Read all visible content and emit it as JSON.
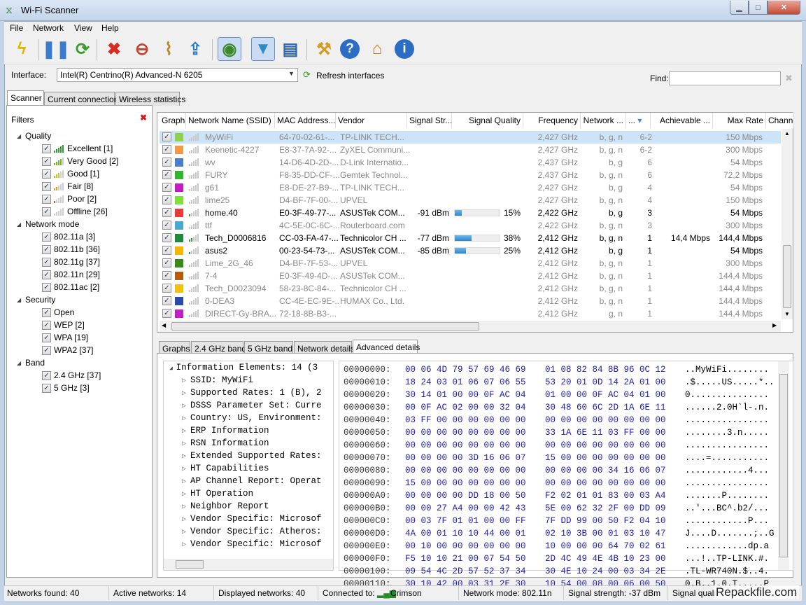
{
  "window": {
    "title": "Wi-Fi Scanner",
    "min": "▭",
    "max": "□",
    "close": "✕"
  },
  "menu": [
    "File",
    "Network",
    "View",
    "Help"
  ],
  "toolbar": [
    {
      "icon": "lightning-icon",
      "glyph": "ϟ",
      "color": "#e8b400"
    },
    {
      "icon": "pause-icon",
      "glyph": "❚❚",
      "color": "#3b7bcf"
    },
    {
      "icon": "refresh-icon",
      "glyph": "⟳",
      "color": "#3a9a2a"
    },
    {
      "icon": "delete-icon",
      "glyph": "✖",
      "color": "#d92b1f"
    },
    {
      "icon": "signal-remove-icon",
      "glyph": "⊖",
      "color": "#c9402f"
    },
    {
      "icon": "broom-icon",
      "glyph": "⌇",
      "color": "#b8862c"
    },
    {
      "icon": "export-icon",
      "glyph": "⇪",
      "color": "#2f7bc4"
    },
    {
      "icon": "rss-alert-icon",
      "glyph": "◉",
      "color": "#3a8a2a"
    },
    {
      "icon": "filter-icon",
      "glyph": "▼",
      "color": "#2f8bc8"
    },
    {
      "icon": "notebook-icon",
      "glyph": "▤",
      "color": "#2f67b0"
    },
    {
      "icon": "wrench-icon",
      "glyph": "⚒",
      "color": "#d59a22"
    },
    {
      "icon": "help-icon",
      "glyph": "?",
      "color": "#2b6cc4"
    },
    {
      "icon": "home-icon",
      "glyph": "⌂",
      "color": "#c47a1a"
    },
    {
      "icon": "info-icon",
      "glyph": "i",
      "color": "#2b6cc4"
    }
  ],
  "interface": {
    "label": "Interface:",
    "value": "Intel(R) Centrino(R) Advanced-N 6205",
    "refresh": "Refresh interfaces",
    "find": "Find:"
  },
  "tabs": [
    "Scanner",
    "Current connection",
    "Wireless statistics"
  ],
  "filters": {
    "title": "Filters",
    "groups": [
      {
        "name": "Quality",
        "items": [
          {
            "label": "Excellent [1]",
            "bars": 5
          },
          {
            "label": "Very Good [2]",
            "bars": 4
          },
          {
            "label": "Good [1]",
            "bars": 3
          },
          {
            "label": "Fair [8]",
            "bars": 2
          },
          {
            "label": "Poor [2]",
            "bars": 1
          },
          {
            "label": "Offline [26]",
            "bars": 0
          }
        ]
      },
      {
        "name": "Network mode",
        "items": [
          {
            "label": "802.11a [3]"
          },
          {
            "label": "802.11b [36]"
          },
          {
            "label": "802.11g [37]"
          },
          {
            "label": "802.11n [29]"
          },
          {
            "label": "802.11ac [2]"
          }
        ]
      },
      {
        "name": "Security",
        "items": [
          {
            "label": "Open"
          },
          {
            "label": "WEP [2]"
          },
          {
            "label": "WPA [19]"
          },
          {
            "label": "WPA2 [37]"
          }
        ]
      },
      {
        "name": "Band",
        "items": [
          {
            "label": "2.4 GHz [37]"
          },
          {
            "label": "5 GHz [3]"
          }
        ]
      }
    ]
  },
  "columns": [
    "Graph",
    "Network Name (SSID)",
    "MAC Address...",
    "Vendor",
    "Signal Str...",
    "Signal Quality",
    "Frequency",
    "Network ...",
    "...",
    "Achievable ...",
    "Max Rate",
    "Chann"
  ],
  "networks": [
    {
      "color": "#8fd14f",
      "ssid": "MyWiFi",
      "mac": "64-70-02-61-...",
      "vendor": "TP-LINK TECH...",
      "signal": "",
      "quality": null,
      "freq": "2,427 GHz",
      "mode": "b, g, n",
      "ch": "6-2",
      "ach": "",
      "max": "150 Mbps",
      "active": false
    },
    {
      "color": "#f39a4a",
      "ssid": "Keenetic-4227",
      "mac": "E8-37-7A-92-...",
      "vendor": "ZyXEL Communi...",
      "signal": "",
      "quality": null,
      "freq": "2,427 GHz",
      "mode": "b, g, n",
      "ch": "6-2",
      "ach": "",
      "max": "300 Mbps",
      "active": false
    },
    {
      "color": "#4a7fc8",
      "ssid": "wv",
      "mac": "14-D6-4D-2D-...",
      "vendor": "D-Link Internatio...",
      "signal": "",
      "quality": null,
      "freq": "2,437 GHz",
      "mode": "b, g",
      "ch": "6",
      "ach": "",
      "max": "54 Mbps",
      "active": false
    },
    {
      "color": "#2fb82f",
      "ssid": "FURY",
      "mac": "F8-35-DD-CF-...",
      "vendor": "Gemtek Technol...",
      "signal": "",
      "quality": null,
      "freq": "2,437 GHz",
      "mode": "b, g, n",
      "ch": "6",
      "ach": "",
      "max": "72,2 Mbps",
      "active": false
    },
    {
      "color": "#c020c0",
      "ssid": "g61",
      "mac": "E8-DE-27-B9-...",
      "vendor": "TP-LINK TECH...",
      "signal": "",
      "quality": null,
      "freq": "2,427 GHz",
      "mode": "b, g",
      "ch": "4",
      "ach": "",
      "max": "54 Mbps",
      "active": false
    },
    {
      "color": "#7fe03a",
      "ssid": "lime25",
      "mac": "D4-BF-7F-00-...",
      "vendor": "UPVEL",
      "signal": "",
      "quality": null,
      "freq": "2,427 GHz",
      "mode": "b, g, n",
      "ch": "4",
      "ach": "",
      "max": "150 Mbps",
      "active": false
    },
    {
      "color": "#e83a3a",
      "ssid": "home.40",
      "mac": "E0-3F-49-77-...",
      "vendor": "ASUSTek COM...",
      "signal": "-91 dBm",
      "quality": 15,
      "freq": "2,422 GHz",
      "mode": "b, g",
      "ch": "3",
      "ach": "",
      "max": "54 Mbps",
      "active": true
    },
    {
      "color": "#4aa8d0",
      "ssid": "ttf",
      "mac": "4C-5E-0C-6C-...",
      "vendor": "Routerboard.com",
      "signal": "",
      "quality": null,
      "freq": "2,422 GHz",
      "mode": "b, g, n",
      "ch": "3",
      "ach": "",
      "max": "300 Mbps",
      "active": false
    },
    {
      "color": "#1f8a3a",
      "ssid": "Tech_D0006816",
      "mac": "CC-03-FA-47-...",
      "vendor": "Technicolor CH ...",
      "signal": "-77 dBm",
      "quality": 38,
      "freq": "2,412 GHz",
      "mode": "b, g, n",
      "ch": "1",
      "ach": "14,4 Mbps",
      "max": "144,4 Mbps",
      "active": true
    },
    {
      "color": "#f5b800",
      "ssid": "asus2",
      "mac": "00-23-54-73-...",
      "vendor": "ASUSTek COM...",
      "signal": "-85 dBm",
      "quality": 25,
      "freq": "2,412 GHz",
      "mode": "b, g",
      "ch": "1",
      "ach": "",
      "max": "54 Mbps",
      "active": true
    },
    {
      "color": "#3a8a1a",
      "ssid": "Lime_2G_46",
      "mac": "D4-BF-7F-53-...",
      "vendor": "UPVEL",
      "signal": "",
      "quality": null,
      "freq": "2,412 GHz",
      "mode": "b, g, n",
      "ch": "1",
      "ach": "",
      "max": "300 Mbps",
      "active": false
    },
    {
      "color": "#b85a10",
      "ssid": "7-4",
      "mac": "E0-3F-49-4D-...",
      "vendor": "ASUSTek COM...",
      "signal": "",
      "quality": null,
      "freq": "2,412 GHz",
      "mode": "b, g, n",
      "ch": "1",
      "ach": "",
      "max": "144,4 Mbps",
      "active": false
    },
    {
      "color": "#f5c010",
      "ssid": "Tech_D0023094",
      "mac": "58-23-8C-84-...",
      "vendor": "Technicolor CH ...",
      "signal": "",
      "quality": null,
      "freq": "2,412 GHz",
      "mode": "b, g, n",
      "ch": "1",
      "ach": "",
      "max": "144,4 Mbps",
      "active": false
    },
    {
      "color": "#2a4aa8",
      "ssid": "0-DEA3",
      "mac": "CC-4E-EC-9E-...",
      "vendor": "HUMAX Co., Ltd.",
      "signal": "",
      "quality": null,
      "freq": "2,412 GHz",
      "mode": "b, g, n",
      "ch": "1",
      "ach": "",
      "max": "144,4 Mbps",
      "active": false
    },
    {
      "color": "#c020c0",
      "ssid": "DIRECT-Gy-BRA...",
      "mac": "72-18-8B-B3-...",
      "vendor": "",
      "signal": "",
      "quality": null,
      "freq": "2,412 GHz",
      "mode": "g, n",
      "ch": "1",
      "ach": "",
      "max": "144,4 Mbps",
      "active": false
    }
  ],
  "bottom_tabs": [
    "Graphs",
    "2.4 GHz band",
    "5 GHz band",
    "Network details",
    "Advanced details"
  ],
  "info_elements": {
    "root": "Information Elements: 14 (3",
    "children": [
      "SSID: MyWiFi",
      "Supported Rates: 1 (B), 2",
      "DSSS Parameter Set: Curre",
      "Country: US, Environment:",
      "ERP Information",
      "RSN Information",
      "Extended Supported Rates:",
      "HT Capabilities",
      "AP Channel Report: Operat",
      "HT Operation",
      "Neighbor Report",
      "Vendor Specific: Microsof",
      "Vendor Specific: Atheros:",
      "Vendor Specific: Microsof"
    ]
  },
  "hex": [
    {
      "off": "00000000:",
      "a": "00 06 4D 79 57 69 46 69",
      "b": "01 08 82 84 8B 96 0C 12",
      "ascii": "..MyWiFi........"
    },
    {
      "off": "00000010:",
      "a": "18 24 03 01 06 07 06 55",
      "b": "53 20 01 0D 14 2A 01 00",
      "ascii": ".$.....US.....*.."
    },
    {
      "off": "00000020:",
      "a": "30 14 01 00 00 0F AC 04",
      "b": "01 00 00 0F AC 04 01 00",
      "ascii": "0..............."
    },
    {
      "off": "00000030:",
      "a": "00 0F AC 02 00 00 32 04",
      "b": "30 48 60 6C 2D 1A 6E 11",
      "ascii": "......2.0H`l-.n."
    },
    {
      "off": "00000040:",
      "a": "03 FF 00 00 00 00 00 00",
      "b": "00 00 00 00 00 00 00 00",
      "ascii": "................"
    },
    {
      "off": "00000050:",
      "a": "00 00 00 00 00 00 00 00",
      "b": "33 1A 6E 11 03 FF 00 00",
      "ascii": "........3.n....."
    },
    {
      "off": "00000060:",
      "a": "00 00 00 00 00 00 00 00",
      "b": "00 00 00 00 00 00 00 00",
      "ascii": "................"
    },
    {
      "off": "00000070:",
      "a": "00 00 00 00 3D 16 06 07",
      "b": "15 00 00 00 00 00 00 00",
      "ascii": "....=..........."
    },
    {
      "off": "00000080:",
      "a": "00 00 00 00 00 00 00 00",
      "b": "00 00 00 00 34 16 06 07",
      "ascii": "............4..."
    },
    {
      "off": "00000090:",
      "a": "15 00 00 00 00 00 00 00",
      "b": "00 00 00 00 00 00 00 00",
      "ascii": "................"
    },
    {
      "off": "000000A0:",
      "a": "00 00 00 00 DD 18 00 50",
      "b": "F2 02 01 01 83 00 03 A4",
      "ascii": ".......P........"
    },
    {
      "off": "000000B0:",
      "a": "00 00 27 A4 00 00 42 43",
      "b": "5E 00 62 32 2F 00 DD 09",
      "ascii": "..'...BC^.b2/..."
    },
    {
      "off": "000000C0:",
      "a": "00 03 7F 01 01 00 00 FF",
      "b": "7F DD 99 00 50 F2 04 10",
      "ascii": "............P..."
    },
    {
      "off": "000000D0:",
      "a": "4A 00 01 10 10 44 00 01",
      "b": "02 10 3B 00 01 03 10 47",
      "ascii": "J....D.......;..G"
    },
    {
      "off": "000000E0:",
      "a": "00 10 00 00 00 00 00 00",
      "b": "10 00 00 00 64 70 02 61",
      "ascii": "............dp.a"
    },
    {
      "off": "000000F0:",
      "a": "F5 10 10 21 00 07 54 50",
      "b": "2D 4C 49 4E 4B 10 23 00",
      "ascii": "...!..TP-LINK.#."
    },
    {
      "off": "00000100:",
      "a": "09 54 4C 2D 57 52 37 34",
      "b": "30 4E 10 24 00 03 34 2E",
      "ascii": ".TL-WR740N.$..4."
    },
    {
      "off": "00000110:",
      "a": "30 10 42 00 03 31 2E 30",
      "b": "10 54 00 08 00 06 00 50",
      "ascii": "0.B..1.0.T.....P"
    }
  ],
  "status": {
    "found": "Networks found: 40",
    "active": "Active networks: 14",
    "displayed": "Displayed networks: 40",
    "connected_label": "Connected to:",
    "connected": "Crimson",
    "mode": "Network mode: 802.11n",
    "strength": "Signal strength: -37 dBm",
    "quality": "Signal quali"
  },
  "watermark": "Repackfile.com"
}
